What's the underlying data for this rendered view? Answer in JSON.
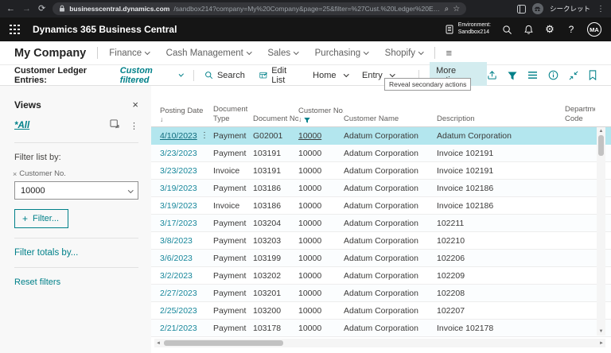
{
  "colors": {
    "accent": "#008089",
    "link": "#17879b",
    "selected_row_bg": "#b3e6ee",
    "app_header_bg": "#151515",
    "chrome_bg": "#202124",
    "more_button_bg": "#d3ecef"
  },
  "icons": {
    "back": "←",
    "forward": "→",
    "refresh": "⟳",
    "zoom": "⌕",
    "star": "☆",
    "menu_dots": "⋮",
    "gear": "⚙",
    "help": "?",
    "hamburger": "≡",
    "close": "×",
    "overflow_dots": "⋮",
    "row_dots": "⋮",
    "plus": "+",
    "remove_filter": "×",
    "sort_desc": "↓",
    "scroll_up": "▲",
    "scroll_down": "▼",
    "scroll_left": "◄",
    "scroll_right": "►"
  },
  "browser": {
    "url_host": "businesscentral.dynamics.com",
    "url_rest": "/sandbox214?company=My%20Company&page=25&filter=%27Cust.%20Ledger%20Entry%27.%27Customer%20No.%27%20I...",
    "profile_label": "シークレット"
  },
  "app_header": {
    "product_name": "Dynamics 365 Business Central",
    "environment_label": "Environment:",
    "environment_value": "Sandbox214",
    "avatar_initials": "MA"
  },
  "nav": {
    "company_name": "My Company",
    "menus": [
      {
        "label": "Finance"
      },
      {
        "label": "Cash Management"
      },
      {
        "label": "Sales"
      },
      {
        "label": "Purchasing"
      },
      {
        "label": "Shopify"
      }
    ]
  },
  "action_bar": {
    "title": "Customer Ledger Entries:",
    "view_label": "Custom filtered",
    "search_label": "Search",
    "edit_list_label": "Edit List",
    "home_label": "Home",
    "entry_label": "Entry",
    "more_label": "More options",
    "tooltip": "Reveal secondary actions"
  },
  "sidebar": {
    "title": "Views",
    "view_all_label": "*All",
    "filter_list_label": "Filter list by:",
    "filter_field_label": "Customer No.",
    "filter_value": "10000",
    "add_filter_label": "Filter...",
    "filter_totals_label": "Filter totals by...",
    "reset_label": "Reset filters"
  },
  "table": {
    "columns": {
      "posting_date": "Posting Date",
      "document_type_l1": "Document",
      "document_type_l2": "Type",
      "document_no": "Document No.",
      "customer_no": "Customer No.",
      "customer_name": "Customer Name",
      "description": "Description",
      "department_l1": "Departme",
      "department_l2": "Code"
    },
    "selected_row_index": 0,
    "rows": [
      {
        "posting_date": "4/10/2023",
        "document_type": "Payment",
        "document_no": "G02001",
        "customer_no": "10000",
        "customer_name": "Adatum Corporation",
        "description": "Adatum Corporation"
      },
      {
        "posting_date": "3/23/2023",
        "document_type": "Payment",
        "document_no": "103191",
        "customer_no": "10000",
        "customer_name": "Adatum Corporation",
        "description": "Invoice 102191"
      },
      {
        "posting_date": "3/23/2023",
        "document_type": "Invoice",
        "document_no": "103191",
        "customer_no": "10000",
        "customer_name": "Adatum Corporation",
        "description": "Invoice 102191"
      },
      {
        "posting_date": "3/19/2023",
        "document_type": "Payment",
        "document_no": "103186",
        "customer_no": "10000",
        "customer_name": "Adatum Corporation",
        "description": "Invoice 102186"
      },
      {
        "posting_date": "3/19/2023",
        "document_type": "Invoice",
        "document_no": "103186",
        "customer_no": "10000",
        "customer_name": "Adatum Corporation",
        "description": "Invoice 102186"
      },
      {
        "posting_date": "3/17/2023",
        "document_type": "Payment",
        "document_no": "103204",
        "customer_no": "10000",
        "customer_name": "Adatum Corporation",
        "description": "102211"
      },
      {
        "posting_date": "3/8/2023",
        "document_type": "Payment",
        "document_no": "103203",
        "customer_no": "10000",
        "customer_name": "Adatum Corporation",
        "description": "102210"
      },
      {
        "posting_date": "3/6/2023",
        "document_type": "Payment",
        "document_no": "103199",
        "customer_no": "10000",
        "customer_name": "Adatum Corporation",
        "description": "102206"
      },
      {
        "posting_date": "3/2/2023",
        "document_type": "Payment",
        "document_no": "103202",
        "customer_no": "10000",
        "customer_name": "Adatum Corporation",
        "description": "102209"
      },
      {
        "posting_date": "2/27/2023",
        "document_type": "Payment",
        "document_no": "103201",
        "customer_no": "10000",
        "customer_name": "Adatum Corporation",
        "description": "102208"
      },
      {
        "posting_date": "2/25/2023",
        "document_type": "Payment",
        "document_no": "103200",
        "customer_no": "10000",
        "customer_name": "Adatum Corporation",
        "description": "102207"
      },
      {
        "posting_date": "2/21/2023",
        "document_type": "Payment",
        "document_no": "103178",
        "customer_no": "10000",
        "customer_name": "Adatum Corporation",
        "description": "Invoice 102178"
      }
    ]
  }
}
